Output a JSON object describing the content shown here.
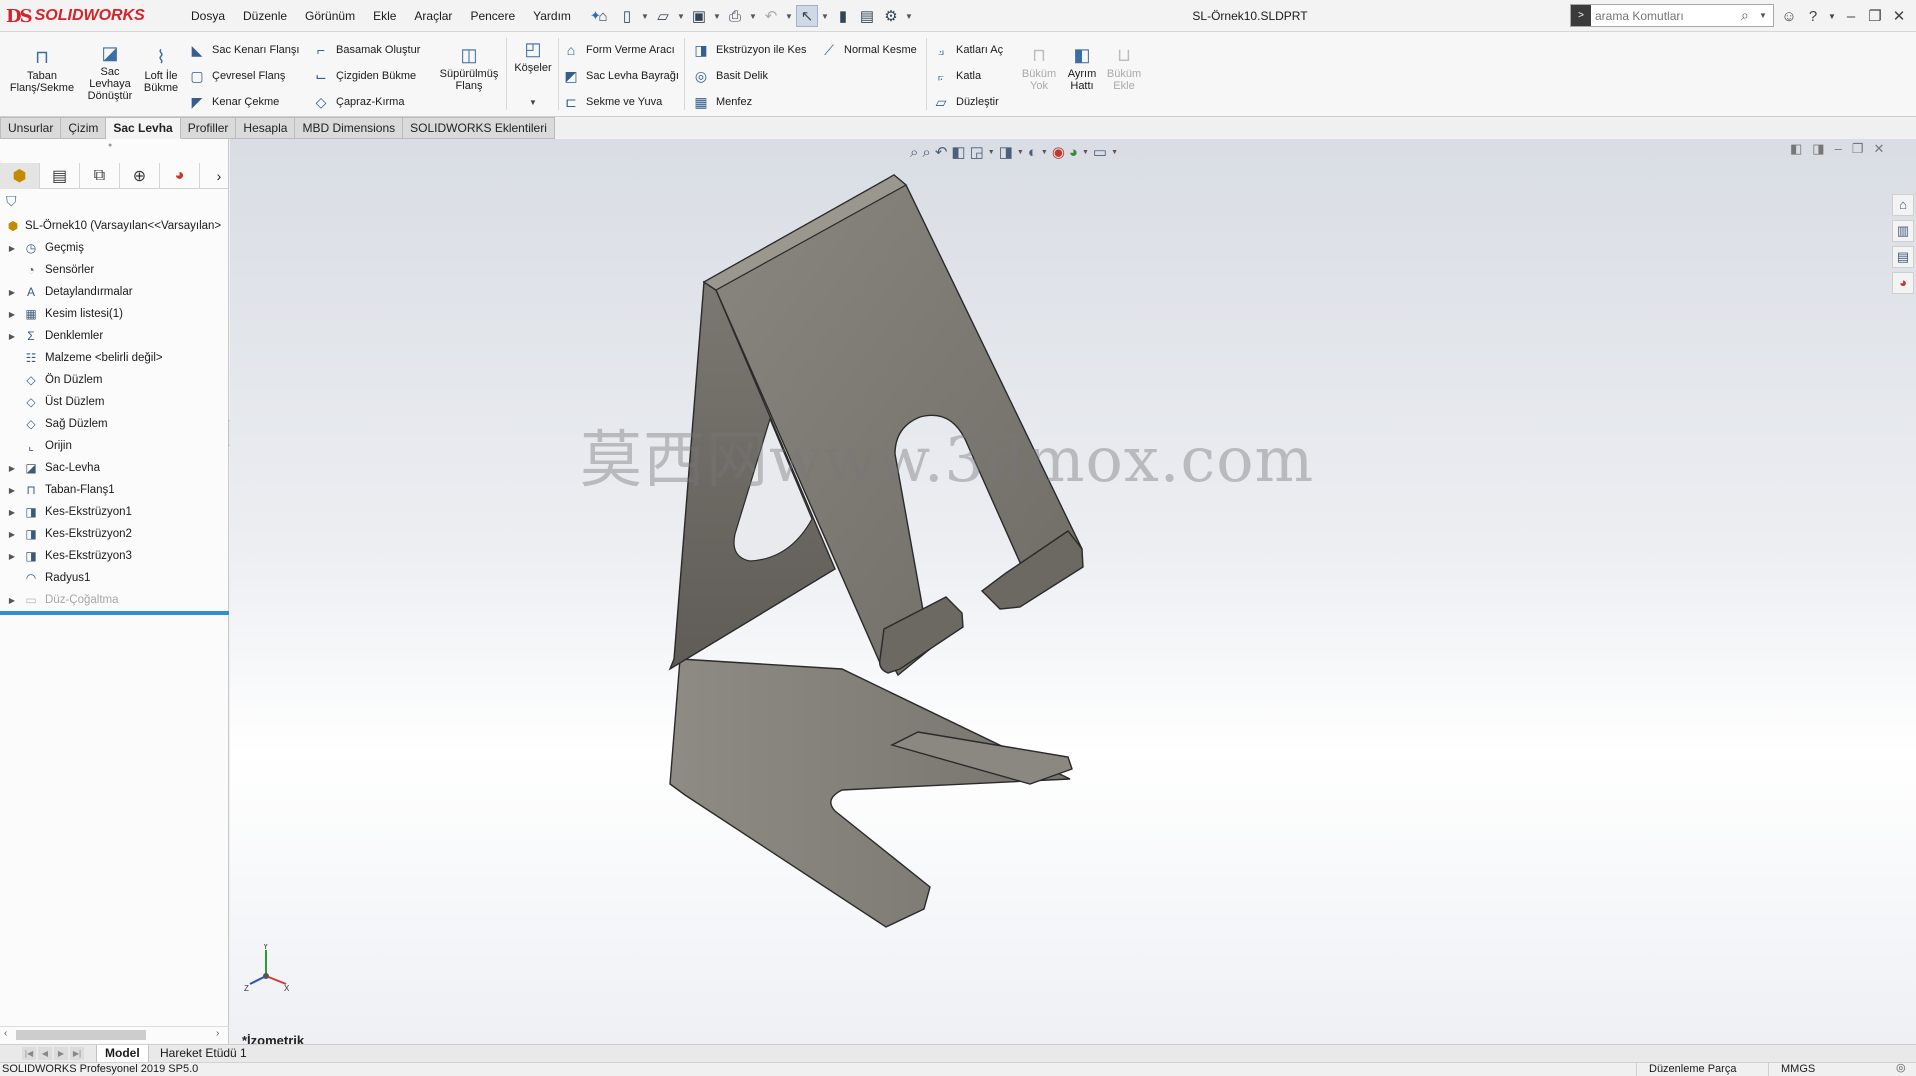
{
  "app": {
    "logo_mark": "DS",
    "logo_text": "SOLIDWORKS",
    "document_title": "SL-Örnek10.SLDPRT"
  },
  "menu": [
    "Dosya",
    "Düzenle",
    "Görünüm",
    "Ekle",
    "Araçlar",
    "Pencere",
    "Yardım"
  ],
  "search": {
    "placeholder": "arama Komutları"
  },
  "command_manager": {
    "taban_flans": "Taban\nFlanş/Sekme",
    "sac_levhaya_donustur": "Sac\nLevhaya\nDönüştür",
    "loft_ile_bukme": "Loft İle\nBükme",
    "sac_kenari_flansi": "Sac Kenarı Flanşı",
    "cevresel_flans": "Çevresel Flanş",
    "kenar_cekme": "Kenar Çekme",
    "basamak_olustur": "Basamak Oluştur",
    "cizgiden_bukme": "Çizgiden Bükme",
    "capraz_kirma": "Çapraz-Kırma",
    "supurulmus_flans": "Süpürülmüş\nFlanş",
    "koseler": "Köşeler",
    "form_verme_araci": "Form Verme Aracı",
    "sac_levha_bayragi": "Sac Levha Bayrağı",
    "sekme_ve_yuva": "Sekme ve Yuva",
    "ekstruzyon_ile_kes": "Ekstrüzyon ile Kes",
    "basit_delik": "Basit Delik",
    "menfez": "Menfez",
    "normal_kesme": "Normal Kesme",
    "katlari_ac": "Katları Aç",
    "katla": "Katla",
    "duzlestir": "Düzleştir",
    "bukum_yok": "Büküm\nYok",
    "ayrim_hatti": "Ayrım\nHattı",
    "bukum_ekle": "Büküm\nEkle"
  },
  "tabs": [
    {
      "label": "Unsurlar",
      "active": false
    },
    {
      "label": "Çizim",
      "active": false
    },
    {
      "label": "Sac Levha",
      "active": true
    },
    {
      "label": "Profiller",
      "active": false
    },
    {
      "label": "Hesapla",
      "active": false
    },
    {
      "label": "MBD Dimensions",
      "active": false
    },
    {
      "label": "SOLIDWORKS Eklentileri",
      "active": false
    }
  ],
  "feature_tree": {
    "root": "SL-Örnek10  (Varsayılan<<Varsayılan>",
    "items": [
      {
        "label": "Geçmiş",
        "icon": "history-icon",
        "expandable": true
      },
      {
        "label": "Sensörler",
        "icon": "sensor-icon",
        "expandable": false
      },
      {
        "label": "Detaylandırmalar",
        "icon": "annotation-icon",
        "expandable": true
      },
      {
        "label": "Kesim listesi(1)",
        "icon": "cut-list-icon",
        "expandable": true
      },
      {
        "label": "Denklemler",
        "icon": "equation-icon",
        "expandable": true
      },
      {
        "label": "Malzeme <belirli değil>",
        "icon": "material-icon",
        "expandable": false
      },
      {
        "label": "Ön Düzlem",
        "icon": "plane-icon",
        "expandable": false
      },
      {
        "label": "Üst Düzlem",
        "icon": "plane-icon",
        "expandable": false
      },
      {
        "label": "Sağ Düzlem",
        "icon": "plane-icon",
        "expandable": false
      },
      {
        "label": "Orijin",
        "icon": "origin-icon",
        "expandable": false
      },
      {
        "label": "Sac-Levha",
        "icon": "sheet-metal-icon",
        "expandable": true
      },
      {
        "label": "Taban-Flanş1",
        "icon": "base-flange-icon",
        "expandable": true
      },
      {
        "label": "Kes-Ekstrüzyon1",
        "icon": "cut-extrude-icon",
        "expandable": true
      },
      {
        "label": "Kes-Ekstrüzyon2",
        "icon": "cut-extrude-icon",
        "expandable": true
      },
      {
        "label": "Kes-Ekstrüzyon3",
        "icon": "cut-extrude-icon",
        "expandable": true
      },
      {
        "label": "Radyus1",
        "icon": "fillet-icon",
        "expandable": false
      },
      {
        "label": "Düz-Çoğaltma",
        "icon": "flat-pattern-icon",
        "expandable": true,
        "suppressed": true
      }
    ]
  },
  "viewport": {
    "watermark": "莫西网www.3dmox.com",
    "view_name": "*İzometrik",
    "part_color": "#7d7a74"
  },
  "bottom_tabs": [
    "Model",
    "Hareket Etüdü 1"
  ],
  "status": {
    "product": "SOLIDWORKS Profesyonel 2019 SP5.0",
    "mode": "Düzenleme Parça",
    "units": "MMGS"
  },
  "colors": {
    "brand_red": "#d6232b",
    "rollback_bar": "#2f8fd0"
  }
}
